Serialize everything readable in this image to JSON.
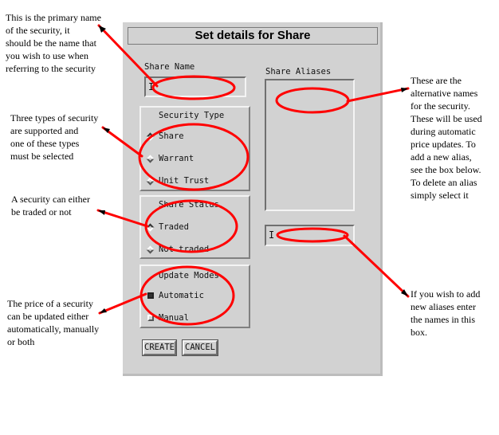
{
  "dialog": {
    "title": "Set details for Share",
    "share_name": {
      "label": "Share Name",
      "value": ""
    },
    "security_type": {
      "label": "Security Type",
      "options": [
        "Share",
        "Warrant",
        "Unit Trust"
      ],
      "selected": "Share"
    },
    "share_status": {
      "label": "Share Status",
      "options": [
        "Traded",
        "Not traded"
      ],
      "selected": "Traded"
    },
    "update_modes": {
      "label": "Update Modes",
      "options": [
        "Automatic",
        "Manual"
      ],
      "checked": [
        "Automatic"
      ]
    },
    "share_aliases": {
      "label": "Share Aliases",
      "items": [],
      "new_alias_value": ""
    },
    "buttons": {
      "create": "CREATE",
      "cancel": "CANCEL"
    }
  },
  "annotations": {
    "share_name": [
      "This is the primary name",
      "of the security, it",
      "should be the name that",
      "you wish to use when",
      "referring to the security"
    ],
    "security_type": [
      "Three types of security",
      "are supported and",
      "one of these types",
      "must be selected"
    ],
    "share_status": [
      "A security can either",
      "be traded or not"
    ],
    "update_modes": [
      "The price of a security",
      "can be updated either",
      "automatically, manually",
      "or both"
    ],
    "share_aliases": [
      "These are the",
      "alternative names",
      "for the security.",
      "These will be used",
      "during automatic",
      "price updates. To",
      "add a new alias,",
      "see the box below.",
      "To delete an alias",
      "simply select it"
    ],
    "new_alias": [
      "If you wish to add",
      "new aliases enter",
      "the names in this",
      "box."
    ]
  },
  "colors": {
    "annotation": "#ff0000",
    "dialog_bg": "#d2d2d2"
  }
}
